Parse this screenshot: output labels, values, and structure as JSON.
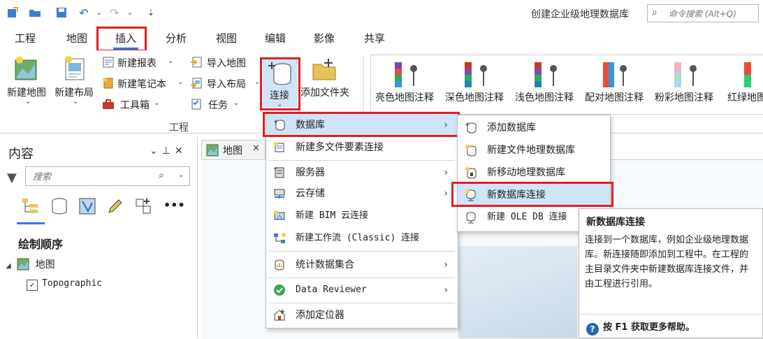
{
  "app": {
    "title": "创建企业级地理数据库",
    "command_search_placeholder": "命令搜索 (Alt+Q)"
  },
  "qat": {
    "icons": [
      "new-project-icon",
      "open-icon",
      "save-icon",
      "undo-icon",
      "redo-icon",
      "customize-icon"
    ]
  },
  "ribbon": {
    "tabs": [
      "工程",
      "地图",
      "插入",
      "分析",
      "视图",
      "编辑",
      "影像",
      "共享"
    ],
    "active_tab": "插入",
    "project_group": {
      "label": "工程",
      "new_map": "新建地图",
      "new_layout": "新建布局",
      "new_report": "新建报表",
      "new_notebook": "新建笔记本",
      "toolbox": "工具箱",
      "import_map": "导入地图",
      "import_layout": "导入布局",
      "task": "任务",
      "connection": "连接",
      "add_folder": "添加文件夹"
    },
    "basemaps": [
      "亮色地图注释",
      "深色地图注释",
      "浅色地图注释",
      "配对地图注释",
      "粉彩地图注释",
      "红绿地图"
    ]
  },
  "contents": {
    "title": "内容",
    "search_placeholder": "搜索",
    "section": "绘制顺序",
    "map_layer": "地图",
    "basemap_layer": "Topographic"
  },
  "map_tab": {
    "label": "地图"
  },
  "connection_menu": {
    "items": [
      {
        "label": "数据库",
        "submenu": true,
        "highlighted": true
      },
      {
        "label": "新建多文件要素连接",
        "submenu": false
      },
      {
        "label": "服务器",
        "submenu": true
      },
      {
        "label": "云存储",
        "submenu": true
      },
      {
        "label": "新建 BIM 云连接",
        "submenu": false
      },
      {
        "label": "新建工作流 (Classic) 连接",
        "submenu": false
      },
      {
        "label": "统计数据集合",
        "submenu": true
      },
      {
        "label": "Data Reviewer",
        "submenu": true
      },
      {
        "label": "添加定位器",
        "submenu": false
      }
    ]
  },
  "database_submenu": {
    "items": [
      {
        "label": "添加数据库"
      },
      {
        "label": "新建文件地理数据库"
      },
      {
        "label": "新移动地理数据库"
      },
      {
        "label": "新数据库连接",
        "highlighted": true
      },
      {
        "label": "新建 OLE DB 连接"
      }
    ]
  },
  "tooltip": {
    "title": "新数据库连接",
    "body": "连接到一个数据库，例如企业级地理数据库。新连接随即添加到工程中。在工程的主目录文件夹中新建数据库连接文件，并由工程进行引用。",
    "help": "按 F1 获取更多帮助。"
  },
  "colors": {
    "highlight": "#cfe4f7",
    "accent": "#2e7dd7",
    "annotation_red": "#e11e26"
  }
}
